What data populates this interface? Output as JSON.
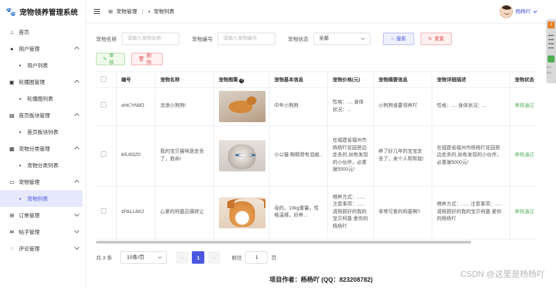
{
  "app": {
    "title": "宠物领养管理系统"
  },
  "sidebar": {
    "items": [
      {
        "label": "首页",
        "icon": "home-icon"
      },
      {
        "label": "用户管理",
        "icon": "user-icon"
      },
      {
        "label": "用户列表",
        "icon": "file-icon"
      },
      {
        "label": "轮播图管理",
        "icon": "image-icon"
      },
      {
        "label": "轮播图列表",
        "icon": "file-icon"
      },
      {
        "label": "首页板块管理",
        "icon": "board-icon"
      },
      {
        "label": "首页板块列表",
        "icon": "file-icon"
      },
      {
        "label": "宠物分类管理",
        "icon": "grid-icon"
      },
      {
        "label": "宠物分类列表",
        "icon": "file-icon"
      },
      {
        "label": "宠物管理",
        "icon": "monitor-icon"
      },
      {
        "label": "宠物列表",
        "icon": "file-icon"
      },
      {
        "label": "订单管理",
        "icon": "cart-icon"
      },
      {
        "label": "帖子管理",
        "icon": "mail-icon"
      },
      {
        "label": "评论管理",
        "icon": "chat-icon"
      }
    ]
  },
  "header": {
    "crumb1": "宠物管理",
    "crumb2": "宠物列表",
    "username": "杨杨吖"
  },
  "monitor": {
    "badge": "2",
    "t1": "0.0",
    "t2": "0.0"
  },
  "filters": {
    "name_label": "宠物名称",
    "name_placeholder": "请输入宠物名称",
    "code_label": "宠物编号",
    "code_placeholder": "请输入宠物编号",
    "status_label": "宠物状态",
    "status_value": "全部",
    "search_label": "搜索",
    "reset_label": "重置"
  },
  "ops": {
    "audit_label": "审核",
    "delete_label": "删除"
  },
  "table": {
    "headers": [
      "编号",
      "宠物名称",
      "宠物图集",
      "宠物基本信息",
      "宠物价格(元)",
      "宠物摘要信息",
      "宠物详细描述",
      "宠物状态"
    ],
    "rows": [
      {
        "code": "ohK7rN8O",
        "name": "流浪小狗狗!",
        "basic": "中年小狗狗",
        "price": "性格：.... 身体状况：...",
        "summary": "小狗狗谁要领养吖",
        "detail": "性格：.... 身体状况：...",
        "status": "审核通过"
      },
      {
        "code": "kilU83Z0",
        "name": "我的宝贝猫咪是走丢了，救命!",
        "basic": "小公猫 眼睛旁有泪痕..",
        "price": "在福建省福州市杨杨吖花园旁边走丢的,如有发现的小伙伴，必重谢5000元!",
        "summary": "养了好几年的宝宝走丢了，来个人帮帮我!",
        "detail": "在福建省福州市杨杨吖花园旁边走丢的,如有发现的小伙伴，必重谢5000元!",
        "status": "审核通过"
      },
      {
        "code": "zFALLAK2",
        "name": "心爱的柯基忍痛转让",
        "basic": "母的，10kg重量，性格温顺，好养...",
        "price": "喂养方式：...... 注意事项：..... 请照顾好的我的宝贝柯基 爱你的杨杨吖",
        "summary": "非常可爱的柯基啊!!",
        "detail": "喂养方式：...... 注意事项：..... 请照顾好的我的宝贝柯基 爱你的杨杨吖",
        "status": "审核通过"
      }
    ]
  },
  "pager": {
    "total": "共 3 条",
    "size": "10条/页",
    "prev": "‹",
    "current": "1",
    "next": "›",
    "goto": "前往",
    "goto_value": "1",
    "page_unit": "页"
  },
  "footer": {
    "text": "项目作者：杨杨吖 (QQ：823208782)"
  },
  "watermark": {
    "text": "CSDN @这里是杨杨吖"
  },
  "colors": {
    "accent": "#4b57e0",
    "success": "#52b35e",
    "danger": "#e25757",
    "brand": "#e74c3c"
  }
}
